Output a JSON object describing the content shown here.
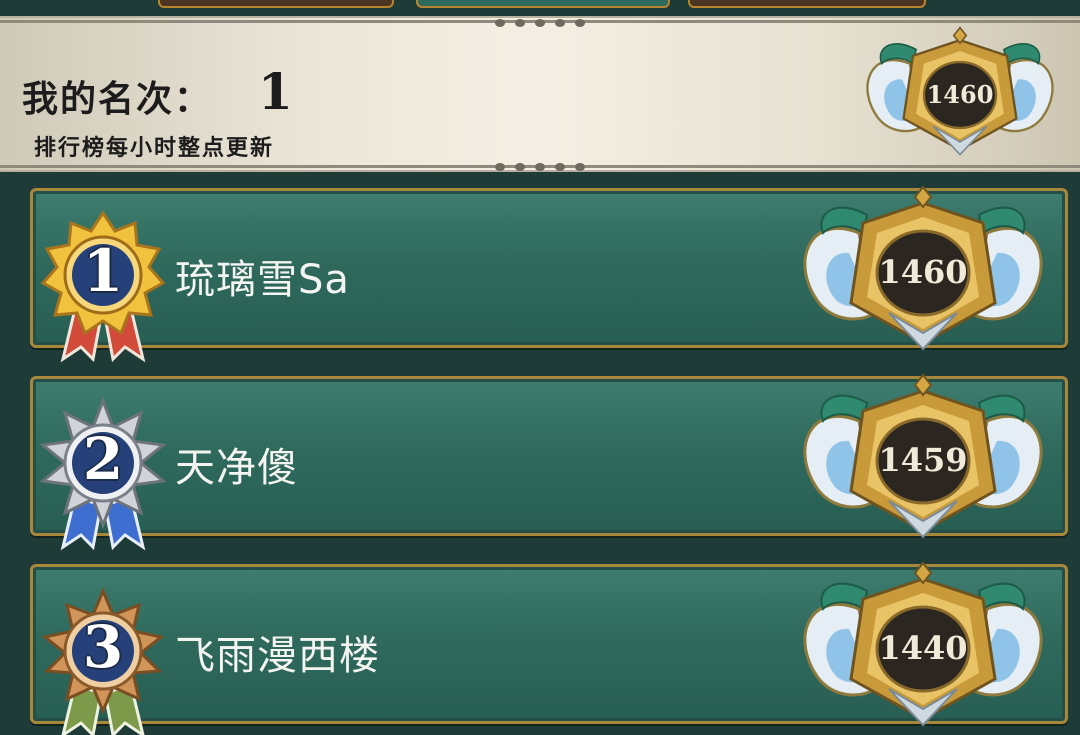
{
  "my_rank": {
    "label": "我的名次：",
    "value": "1",
    "note": "排行榜每小时整点更新",
    "score": "1460"
  },
  "leaderboard": [
    {
      "rank": "1",
      "name": "琉璃雪Sa",
      "score": "1460",
      "medal": "gold-medal-icon"
    },
    {
      "rank": "2",
      "name": "天净傻",
      "score": "1459",
      "medal": "silver-medal-icon"
    },
    {
      "rank": "3",
      "name": "飞雨漫西楼",
      "score": "1440",
      "medal": "bronze-medal-icon"
    }
  ],
  "colors": {
    "background": "#1f3b37",
    "row": "#2f6a5d",
    "border_gold": "#a8873b",
    "gold": "#e7b63a",
    "silver": "#c9ccd0",
    "bronze": "#c98a4a"
  }
}
